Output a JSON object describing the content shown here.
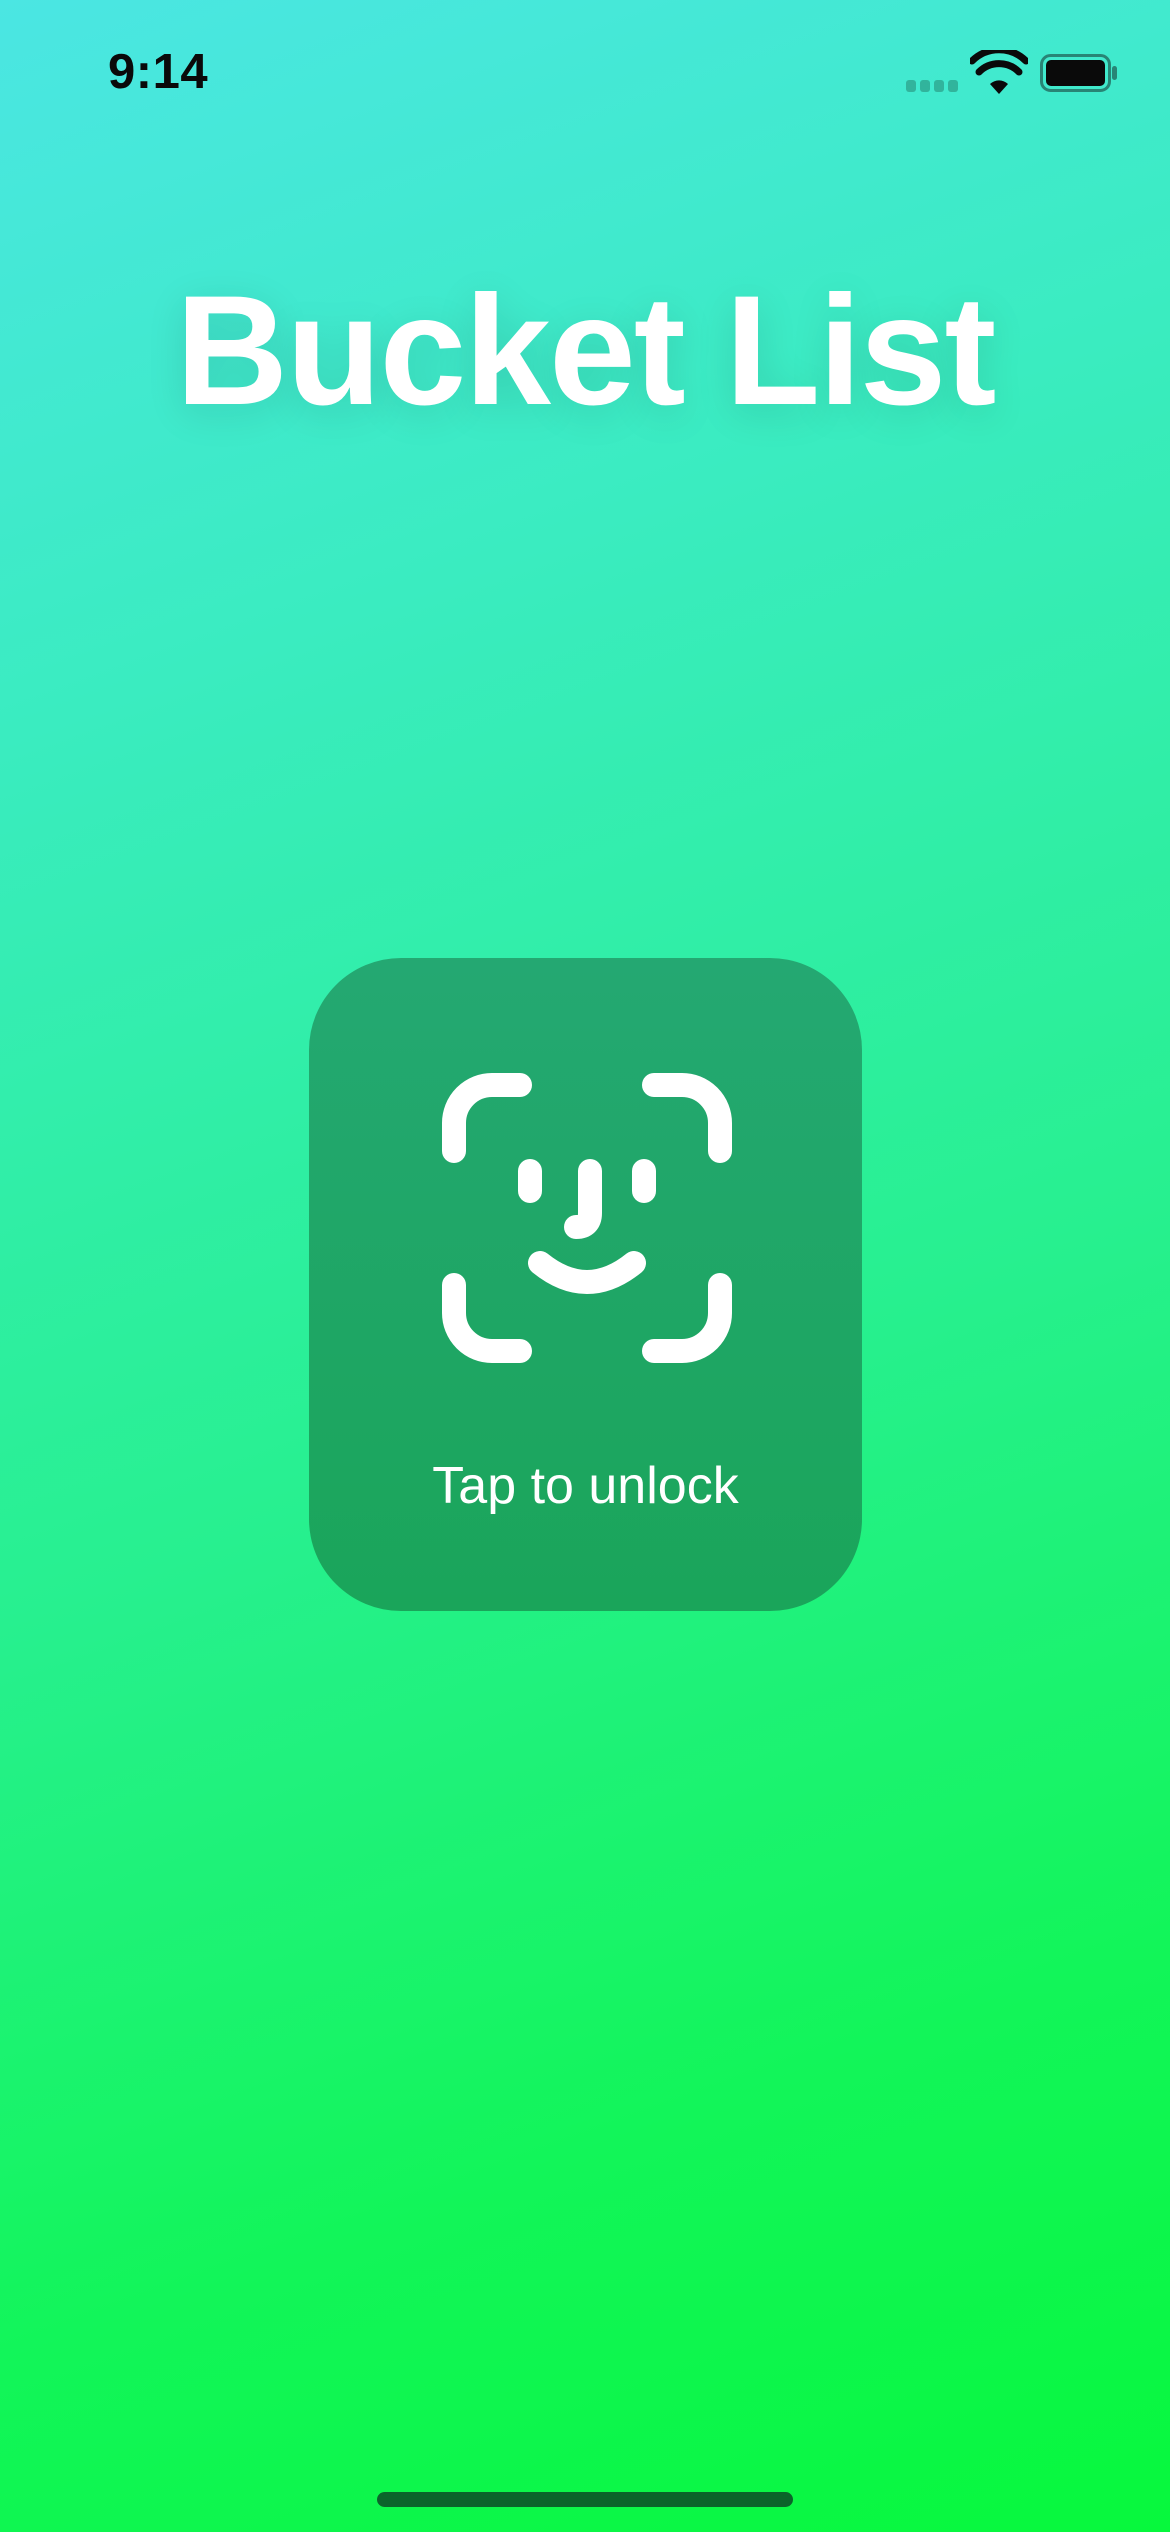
{
  "status_bar": {
    "time": "9:14",
    "icons": [
      "cellular-signal-icon",
      "wifi-icon",
      "battery-icon"
    ]
  },
  "app": {
    "title": "Bucket List"
  },
  "unlock": {
    "icon": "face-id-icon",
    "label": "Tap to unlock"
  },
  "colors": {
    "gradient_top": "#4be6e3",
    "gradient_bottom": "#07f83c",
    "card": "#1fa766",
    "text": "#ffffff"
  }
}
